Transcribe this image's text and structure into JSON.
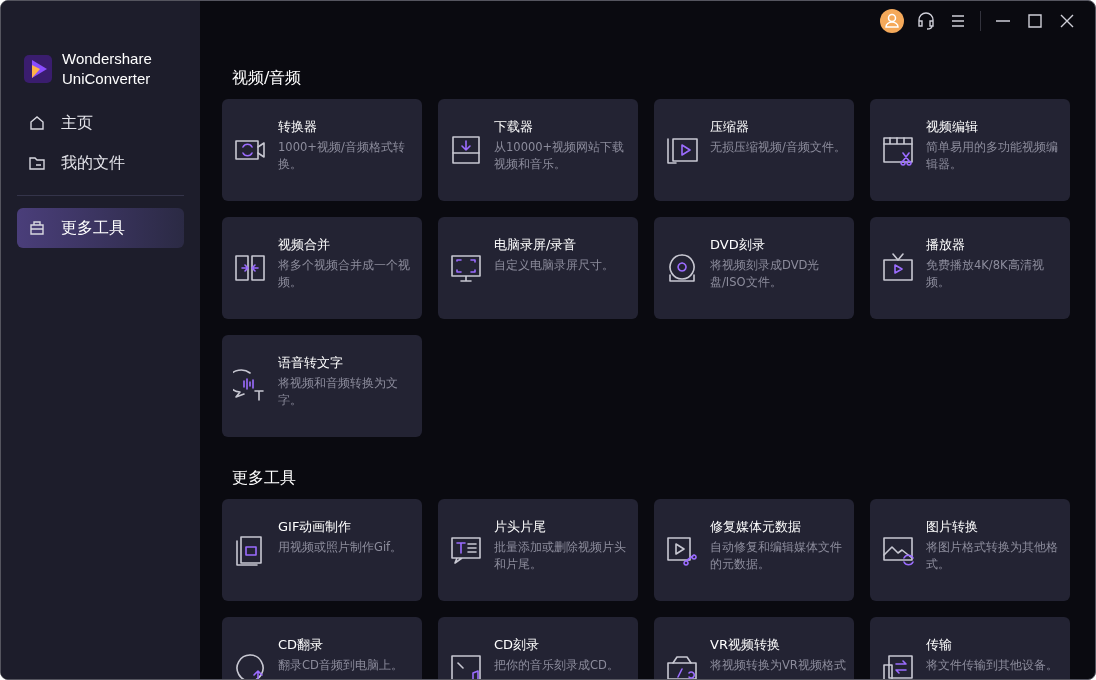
{
  "app": {
    "name_line1": "Wondershare",
    "name_line2": "UniConverter"
  },
  "sidebar": {
    "items": [
      {
        "label": "主页",
        "selected": false
      },
      {
        "label": "我的文件",
        "selected": false
      }
    ],
    "tools_items": [
      {
        "label": "更多工具",
        "selected": true
      }
    ]
  },
  "sections": [
    {
      "title": "视频/音频",
      "cards": [
        {
          "title": "转换器",
          "description": "1000+视频/音频格式转换。"
        },
        {
          "title": "下载器",
          "description": "从10000+视频网站下载视频和音乐。"
        },
        {
          "title": "压缩器",
          "description": "无损压缩视频/音频文件。"
        },
        {
          "title": "视频编辑",
          "description": "简单易用的多功能视频编辑器。"
        },
        {
          "title": "视频合并",
          "description": "将多个视频合并成一个视频。"
        },
        {
          "title": "电脑录屏/录音",
          "description": "自定义电脑录屏尺寸。"
        },
        {
          "title": "DVD刻录",
          "description": "将视频刻录成DVD光盘/ISO文件。"
        },
        {
          "title": "播放器",
          "description": "免费播放4K/8K高清视频。"
        },
        {
          "title": "语音转文字",
          "description": "将视频和音频转换为文字。"
        }
      ]
    },
    {
      "title": "更多工具",
      "cards": [
        {
          "title": "GIF动画制作",
          "description": "用视频或照片制作Gif。"
        },
        {
          "title": "片头片尾",
          "description": "批量添加或删除视频片头和片尾。"
        },
        {
          "title": "修复媒体元数据",
          "description": "自动修复和编辑媒体文件的元数据。"
        },
        {
          "title": "图片转换",
          "description": "将图片格式转换为其他格式。"
        },
        {
          "title": "CD翻录",
          "description": "翻录CD音频到电脑上。"
        },
        {
          "title": "CD刻录",
          "description": "把你的音乐刻录成CD。"
        },
        {
          "title": "VR视频转换",
          "description": "将视频转换为VR视频格式"
        },
        {
          "title": "传输",
          "description": "将文件传输到其他设备。"
        }
      ]
    }
  ]
}
